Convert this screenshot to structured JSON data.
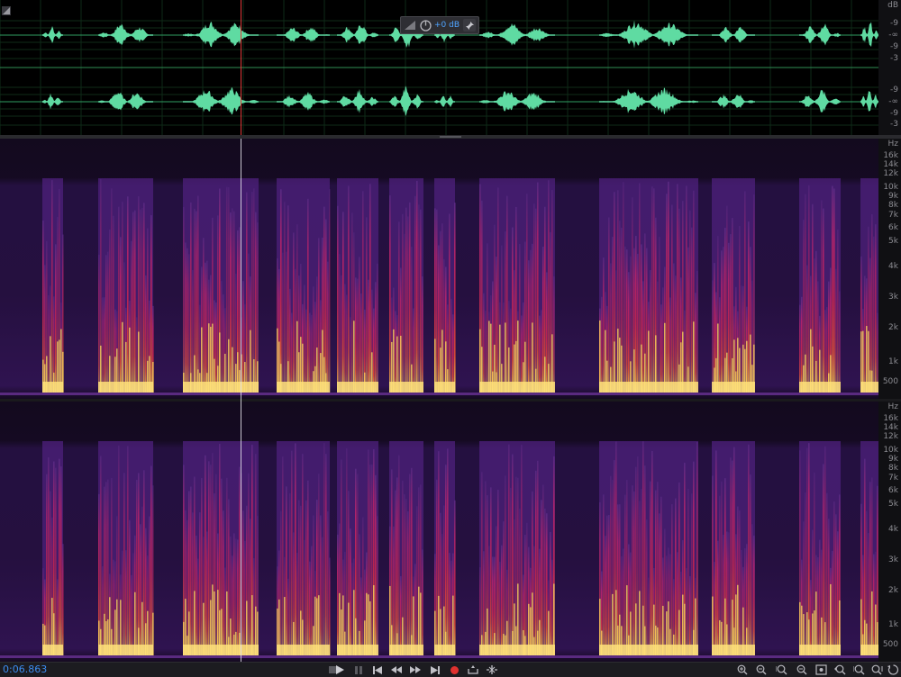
{
  "app": {
    "view": "waveform-spectral"
  },
  "waveform": {
    "db_ticks_top": [
      "dB",
      "-9",
      "-∞",
      "-9",
      "-3"
    ],
    "db_ticks_bottom": [
      "-9",
      "-∞",
      "-9",
      "-3"
    ],
    "wave_color": "#5fdba2",
    "centerline_color": "#2f9e62"
  },
  "hud": {
    "gain_label": "+0 dB"
  },
  "spectral": {
    "hz_ticks": [
      "Hz",
      "16k",
      "14k",
      "12k",
      "10k",
      "9k",
      "8k",
      "7k",
      "6k",
      "5k",
      "4k",
      "3k",
      "2k",
      "1k",
      "500"
    ]
  },
  "playhead": {
    "color": "#e23b3b"
  },
  "transport": {
    "time": "0:06.863",
    "buttons": [
      "stop",
      "play",
      "pause",
      "go-to-start",
      "rewind",
      "fast-forward",
      "go-to-end",
      "record",
      "skip-selection",
      "loop"
    ],
    "record_color": "#e0312f"
  },
  "zoom": {
    "buttons": [
      "zoom-in-amplitude",
      "zoom-out-amplitude",
      "zoom-in-time",
      "zoom-out-time",
      "zoom-full",
      "zoom-in-selection",
      "zoom-in-left",
      "zoom-in-right",
      "zoom-reset"
    ]
  },
  "speech_segments": [
    [
      47,
      70
    ],
    [
      109,
      170
    ],
    [
      203,
      287
    ],
    [
      307,
      366
    ],
    [
      374,
      420
    ],
    [
      432,
      470
    ],
    [
      482,
      505
    ],
    [
      532,
      616
    ],
    [
      665,
      775
    ],
    [
      790,
      838
    ],
    [
      887,
      933
    ],
    [
      955,
      975
    ]
  ]
}
